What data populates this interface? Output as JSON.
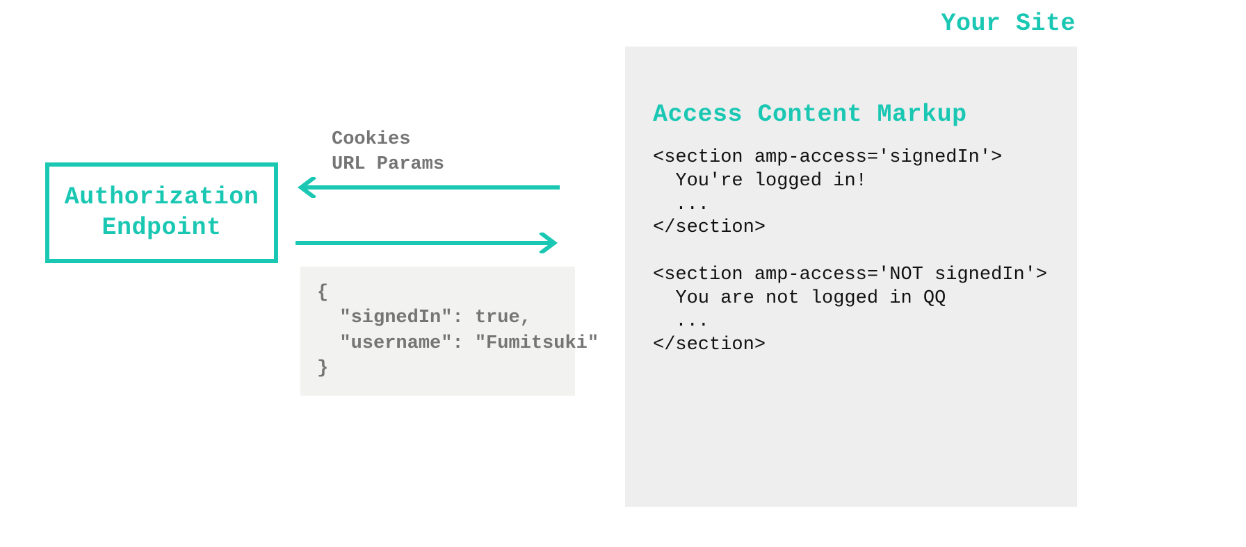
{
  "header": {
    "your_site": "Your Site"
  },
  "auth_box": {
    "line1": "Authorization",
    "line2": "Endpoint"
  },
  "request_labels": {
    "line1": "Cookies",
    "line2": "URL Params"
  },
  "response_json": "{\n  \"signedIn\": true,\n  \"username\": \"Fumitsuki\"\n}",
  "panel": {
    "heading": "Access Content Markup",
    "code": "<section amp-access='signedIn'>\n  You're logged in!\n  ...\n</section>\n\n<section amp-access='NOT signedIn'>\n  You are not logged in QQ\n  ...\n</section>"
  },
  "colors": {
    "accent": "#1aC7B3",
    "muted": "#757575",
    "panel_bg": "#eeeeee",
    "code_bg": "#f2f2f0"
  }
}
